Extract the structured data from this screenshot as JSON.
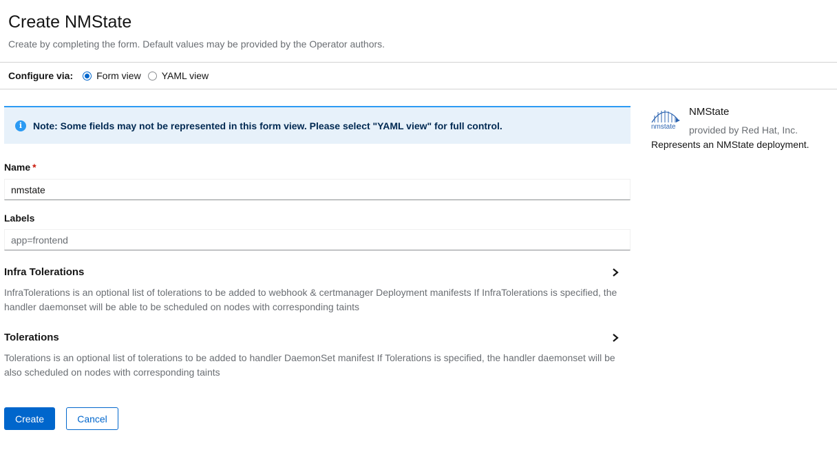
{
  "header": {
    "title": "Create NMState",
    "subtitle": "Create by completing the form. Default values may be provided by the Operator authors."
  },
  "configure": {
    "label": "Configure via:",
    "options": [
      {
        "label": "Form view",
        "checked": true
      },
      {
        "label": "YAML view",
        "checked": false
      }
    ]
  },
  "alert": {
    "icon": "info-icon",
    "text": "Note: Some fields may not be represented in this form view. Please select \"YAML view\" for full control."
  },
  "form": {
    "name": {
      "label": "Name",
      "required_marker": "*",
      "value": "nmstate"
    },
    "labels": {
      "label": "Labels",
      "placeholder": "app=frontend"
    },
    "sections": [
      {
        "title": "Infra Tolerations",
        "description": "InfraTolerations is an optional list of tolerations to be added to webhook & certmanager Deployment manifests If InfraTolerations is specified, the handler daemonset will be able to be scheduled on nodes with corresponding taints"
      },
      {
        "title": "Tolerations",
        "description": "Tolerations is an optional list of tolerations to be added to handler DaemonSet manifest If Tolerations is specified, the handler daemonset will be also scheduled on nodes with corresponding taints"
      }
    ],
    "create_label": "Create",
    "cancel_label": "Cancel"
  },
  "sidebar": {
    "logo_text": "nmstate",
    "title": "NMState",
    "provider": "provided by Red Hat, Inc.",
    "description": "Represents an NMState deployment."
  },
  "colors": {
    "primary": "#0066cc",
    "info": "#2b9af3",
    "alert_bg": "#e7f1fa",
    "required": "#c9190b"
  }
}
